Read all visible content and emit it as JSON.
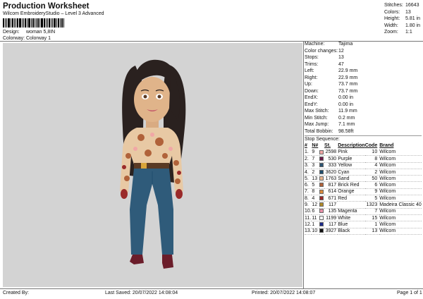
{
  "header": {
    "title": "Production Worksheet",
    "subtitle": "Wilcom EmbroideryStudio – Level 3 Advanced",
    "design_label": "Design:",
    "design_value": "woman 5,8IN",
    "colorway_label": "Colorway:",
    "colorway_value": "Colorway 1"
  },
  "stats": [
    {
      "label": "Stitches:",
      "value": "16643"
    },
    {
      "label": "Colors:",
      "value": "13"
    },
    {
      "label": "Height:",
      "value": "5.81 in"
    },
    {
      "label": "Width:",
      "value": "1.80 in"
    },
    {
      "label": "Zoom:",
      "value": "1:1"
    }
  ],
  "machine_info": [
    {
      "label": "Machine:",
      "value": "Tajima"
    },
    {
      "label": "Color changes:",
      "value": "12"
    },
    {
      "label": "Stops:",
      "value": "13"
    },
    {
      "label": "Trims:",
      "value": "47"
    },
    {
      "label": "Left:",
      "value": "22.9 mm"
    },
    {
      "label": "Right:",
      "value": "22.9 mm"
    },
    {
      "label": "Up:",
      "value": "73.7 mm"
    },
    {
      "label": "Down:",
      "value": "73.7 mm"
    },
    {
      "label": "EndX:",
      "value": "0.00 in"
    },
    {
      "label": "EndY:",
      "value": "0.00 in"
    },
    {
      "label": "Max Stitch:",
      "value": "11.9 mm"
    },
    {
      "label": "Min Stitch:",
      "value": "0.2 mm"
    },
    {
      "label": "Max Jump:",
      "value": "7.1 mm"
    },
    {
      "label": "Total Bobbin:",
      "value": "98.58ft"
    }
  ],
  "sequence": {
    "title": "Stop Sequence:",
    "headers": {
      "n": "#",
      "num": "N#",
      "st": "St.",
      "desc": "Description",
      "code": "Code",
      "brand": "Brand"
    },
    "rows": [
      {
        "n": "1.",
        "num": "9",
        "color": "#f1a7a6",
        "st": "2598",
        "desc": "Pink",
        "code": "10",
        "brand": "Wilcom"
      },
      {
        "n": "2.",
        "num": "7",
        "color": "#6b1d4a",
        "st": "530",
        "desc": "Purple",
        "code": "8",
        "brand": "Wilcom"
      },
      {
        "n": "3.",
        "num": "3",
        "color": "#2b5473",
        "st": "333",
        "desc": "Yellow",
        "code": "4",
        "brand": "Wilcom"
      },
      {
        "n": "4.",
        "num": "2",
        "color": "#1f4e6d",
        "st": "3620",
        "desc": "Cyan",
        "code": "2",
        "brand": "Wilcom"
      },
      {
        "n": "5.",
        "num": "13",
        "color": "#e8b48c",
        "st": "1763",
        "desc": "Sand",
        "code": "50",
        "brand": "Wilcom"
      },
      {
        "n": "6.",
        "num": "5",
        "color": "#b0623a",
        "st": "817",
        "desc": "Brick Red",
        "code": "6",
        "brand": "Wilcom"
      },
      {
        "n": "7.",
        "num": "8",
        "color": "#d98a3c",
        "st": "614",
        "desc": "Orange",
        "code": "9",
        "brand": "Wilcom"
      },
      {
        "n": "8.",
        "num": "4",
        "color": "#9a2a2a",
        "st": "671",
        "desc": "Red",
        "code": "5",
        "brand": "Wilcom"
      },
      {
        "n": "9.",
        "num": "12",
        "color": "#b08a2a",
        "st": "117",
        "desc": "",
        "code": "1323",
        "brand": "Madeira Classic 40"
      },
      {
        "n": "10.",
        "num": "6",
        "color": "#e68fa6",
        "st": "135",
        "desc": "Magenta",
        "code": "7",
        "brand": "Wilcom"
      },
      {
        "n": "11.",
        "num": "11",
        "color": "#ffffff",
        "st": "1199",
        "desc": "White",
        "code": "15",
        "brand": "Wilcom"
      },
      {
        "n": "12.",
        "num": "1",
        "color": "#1b2a8a",
        "st": "117",
        "desc": "Blue",
        "code": "1",
        "brand": "Wilcom"
      },
      {
        "n": "13.",
        "num": "10",
        "color": "#111111",
        "st": "3927",
        "desc": "Black",
        "code": "13",
        "brand": "Wilcom"
      }
    ]
  },
  "footer": {
    "created_by": "Created By:",
    "last_saved": "Last Saved: 20/07/2022 14:08:04",
    "printed": "Printed: 20/07/2022 14:08:07",
    "page": "Page 1 of 1"
  }
}
